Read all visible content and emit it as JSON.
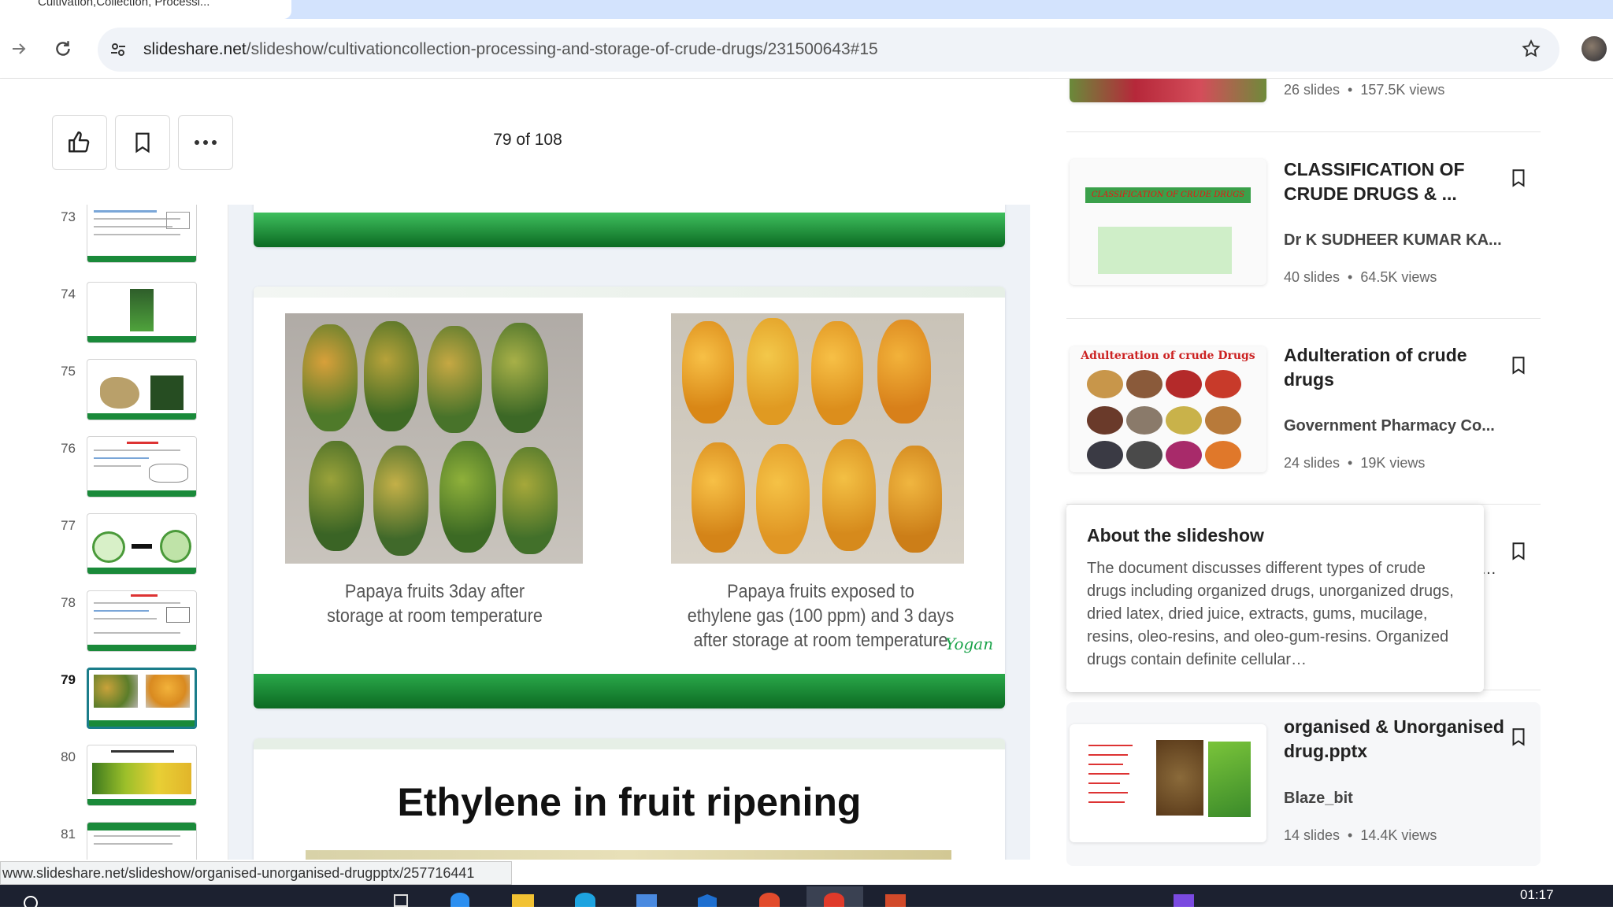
{
  "browser": {
    "tab_title": "Cultivation,Collection, Processi...",
    "url_host": "slideshare.net",
    "url_path": "/slideshow/cultivationcollection-processing-and-storage-of-crude-drugs/231500643#15"
  },
  "viewer": {
    "page_counter": "79 of 108",
    "thumbnails": [
      {
        "num": "73"
      },
      {
        "num": "74"
      },
      {
        "num": "75"
      },
      {
        "num": "76"
      },
      {
        "num": "77"
      },
      {
        "num": "78"
      },
      {
        "num": "79"
      },
      {
        "num": "80"
      },
      {
        "num": "81"
      }
    ],
    "active_slide": "79",
    "slide79": {
      "caption_left": [
        "Papaya fruits 3day after",
        "storage at room temperature"
      ],
      "caption_right": [
        "Papaya fruits exposed to",
        "ethylene gas (100 ppm) and 3 days",
        "after storage at room temperature"
      ],
      "signature": "Yogan"
    },
    "slide80": {
      "title": "Ethylene in fruit ripening"
    }
  },
  "sidebar": {
    "cards": [
      {
        "title": "",
        "author": "",
        "slides": "26 slides",
        "views": "157.5K views"
      },
      {
        "title": "CLASSIFICATION OF CRUDE DRUGS & ...",
        "author": "Dr K SUDHEER KUMAR KA...",
        "slides": "40 slides",
        "views": "64.5K views",
        "thumb_text": "CLASSIFICATION OF CRUDE DRUGS"
      },
      {
        "title": "Adulteration of crude drugs",
        "author": "Government Pharmacy Co...",
        "slides": "24 slides",
        "views": "19K views",
        "thumb_text": "Adulteration of crude Drugs"
      },
      {
        "title": "organised & Unorganised drug.pptx",
        "author": "Blaze_bit",
        "slides": "14 slides",
        "views": "14.4K views"
      }
    ],
    "about": {
      "title": "About the slideshow",
      "text": "The document discusses different types of crude drugs including organized drugs, unorganized drugs, dried latex, dried juice, extracts, gums, mucilage, resins, oleo-resins, and oleo-gum-resins. Organized drugs contain definite cellular…"
    }
  },
  "status": {
    "hover_url": "www.slideshare.net/slideshow/organised-unorganised-drugpptx/257716441"
  },
  "taskbar": {
    "clock": "01:17"
  },
  "colors": {
    "accent_green": "#0c6a22",
    "active_thumb": "#1b7d8a"
  }
}
